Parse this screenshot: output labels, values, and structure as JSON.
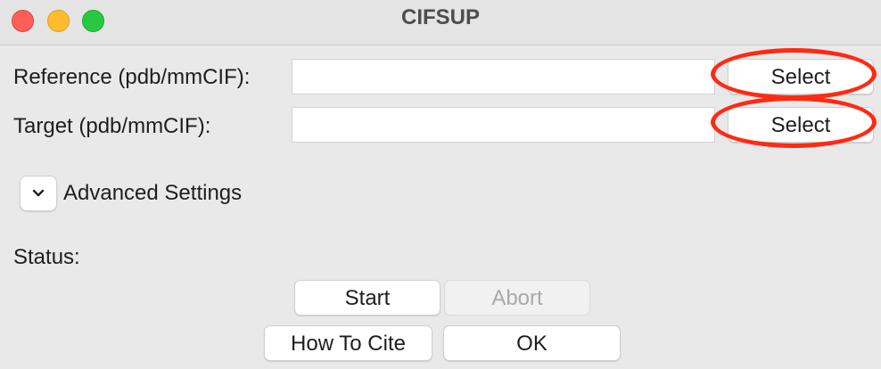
{
  "window": {
    "title": "CIFSUP"
  },
  "form": {
    "reference": {
      "label": "Reference (pdb/mmCIF):",
      "value": "",
      "button_label": "Select"
    },
    "target": {
      "label": "Target (pdb/mmCIF):",
      "value": "",
      "button_label": "Select"
    }
  },
  "advanced": {
    "label": "Advanced Settings",
    "icon": "chevron-down-icon",
    "expanded": false
  },
  "status": {
    "label": "Status:",
    "value": ""
  },
  "actions": {
    "start_label": "Start",
    "abort_label": "Abort",
    "how_to_cite_label": "How To Cite",
    "ok_label": "OK"
  },
  "colors": {
    "annotation": "#ff2a12",
    "close": "#ff5f57",
    "minimize": "#febc2e",
    "maximize": "#28c840"
  }
}
